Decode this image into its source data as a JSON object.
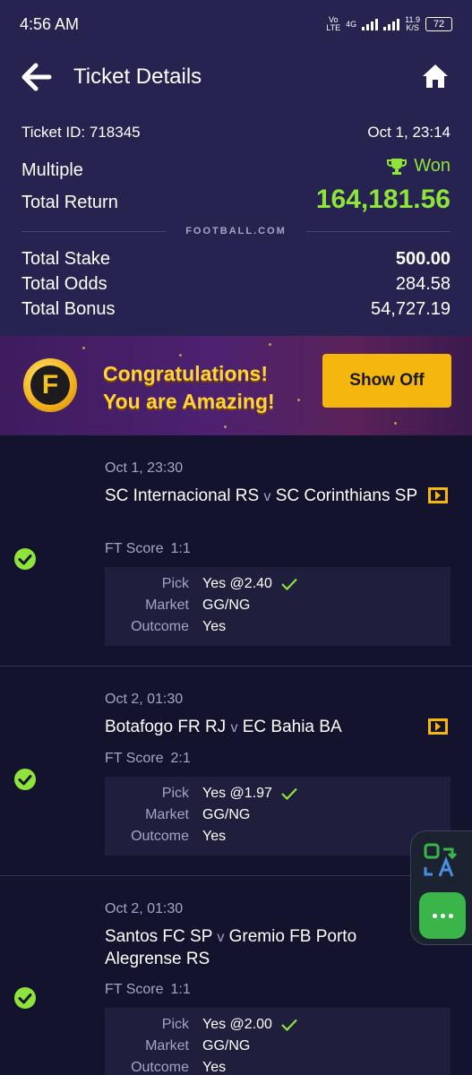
{
  "status": {
    "time": "4:56 AM",
    "net1": "Vo",
    "net2": "LTE",
    "sig": "4G",
    "speed": "11.9",
    "speed_unit": "K/S",
    "battery": "72"
  },
  "header": {
    "title": "Ticket Details"
  },
  "ticket": {
    "id_label": "Ticket ID: 718345",
    "datetime": "Oct 1, 23:14",
    "type": "Multiple",
    "status": "Won",
    "return_label": "Total Return",
    "return_value": "164,181.56",
    "brand": "FOOTBALL.COM",
    "stake_label": "Total Stake",
    "stake_value": "500.00",
    "odds_label": "Total Odds",
    "odds_value": "284.58",
    "bonus_label": "Total Bonus",
    "bonus_value": "54,727.19"
  },
  "banner": {
    "logo_letter": "F",
    "line1": "Congratulations!",
    "line2": "You are Amazing!",
    "button_label": "Show Off"
  },
  "matches": [
    {
      "date": "Oct 1, 23:30",
      "home": "SC Internacional RS",
      "v": "v",
      "away": "SC Corinthians SP",
      "score_label": "FT Score",
      "score": "1:1",
      "pick_label": "Pick",
      "pick": "Yes @2.40",
      "market_label": "Market",
      "market": "GG/NG",
      "outcome_label": "Outcome",
      "outcome": "Yes"
    },
    {
      "date": "Oct 2, 01:30",
      "home": "Botafogo FR RJ",
      "v": "v",
      "away": "EC Bahia BA",
      "score_label": "FT Score",
      "score": "2:1",
      "pick_label": "Pick",
      "pick": "Yes @1.97",
      "market_label": "Market",
      "market": "GG/NG",
      "outcome_label": "Outcome",
      "outcome": "Yes"
    },
    {
      "date": "Oct 2, 01:30",
      "home": "Santos FC SP",
      "v": "v",
      "away": "Gremio FB Porto Alegrense RS",
      "score_label": "FT Score",
      "score": "1:1",
      "pick_label": "Pick",
      "pick": "Yes @2.00",
      "market_label": "Market",
      "market": "GG/NG",
      "outcome_label": "Outcome",
      "outcome": "Yes"
    }
  ],
  "colors": {
    "accent_green": "#8ee43a",
    "header_bg": "#262350",
    "page_bg": "#14132e",
    "button_yellow": "#f5b70e"
  },
  "icons": {
    "back": "arrow-left-icon",
    "home": "home-icon",
    "trophy": "trophy-icon",
    "check": "check-circle-icon",
    "flag": "match-tracker-icon",
    "translate": "translate-icon",
    "more": "more-dots-icon"
  }
}
